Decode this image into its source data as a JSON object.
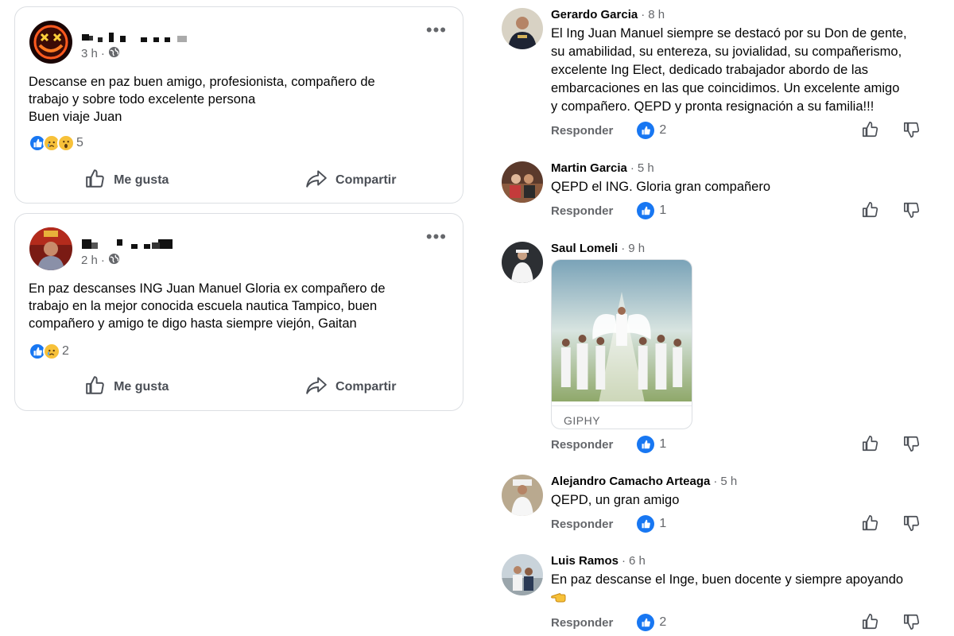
{
  "posts": [
    {
      "time": "3 h",
      "lines": [
        "Descanse en paz buen amigo, profesionista, compañero de",
        "trabajo y sobre todo excelente persona",
        "Buen viaje Juan"
      ],
      "reaction_count": "5",
      "like_label": "Me gusta",
      "share_label": "Compartir"
    },
    {
      "time": "2 h",
      "lines": [
        "En paz descanses ING Juan Manuel Gloria ex compañero de",
        "trabajo en la mejor conocida escuela nautica Tampico, buen",
        "compañero y amigo te digo hasta siempre viejón, Gaitan"
      ],
      "reaction_count": "2",
      "like_label": "Me gusta",
      "share_label": "Compartir"
    }
  ],
  "comments": [
    {
      "name": "Gerardo Garcia",
      "time": "8 h",
      "lines": [
        "El Ing Juan Manuel siempre se destacó por su Don de gente,",
        "su amabilidad, su entereza, su jovialidad, su compañerismo,",
        "excelente Ing Elect, dedicado trabajador abordo de las",
        "embarcaciones en las que coincidimos. Un excelente amigo",
        "y compañero. QEPD y pronta resignación a su familia!!!"
      ],
      "reply_label": "Responder",
      "likes": "2"
    },
    {
      "name": "Martin Garcia",
      "time": "5 h",
      "lines": [
        "QEPD el ING. Gloria gran compañero"
      ],
      "reply_label": "Responder",
      "likes": "1"
    },
    {
      "name": "Saul Lomeli",
      "time": "9 h",
      "lines": [],
      "giphy_label": "GIPHY",
      "reply_label": "Responder",
      "likes": "1"
    },
    {
      "name": "Alejandro Camacho Arteaga",
      "time": "5 h",
      "lines": [
        "QEPD, un gran amigo"
      ],
      "reply_label": "Responder",
      "likes": "1"
    },
    {
      "name": "Luis Ramos",
      "time": "6 h",
      "lines": [
        "En paz descanse el Inge, buen docente y siempre apoyando"
      ],
      "reply_label": "Responder",
      "likes": "2"
    }
  ],
  "colors": {
    "like_blue": "#1877f2",
    "muted": "#65676b",
    "border": "#dcdfe3"
  },
  "icons": [
    "more-options-icon",
    "globe-icon",
    "thumbs-up-icon",
    "share-arrow-icon",
    "thumbs-down-icon",
    "like-reaction-icon",
    "sad-reaction-icon",
    "wow-reaction-icon",
    "pointing-hand-emoji"
  ]
}
